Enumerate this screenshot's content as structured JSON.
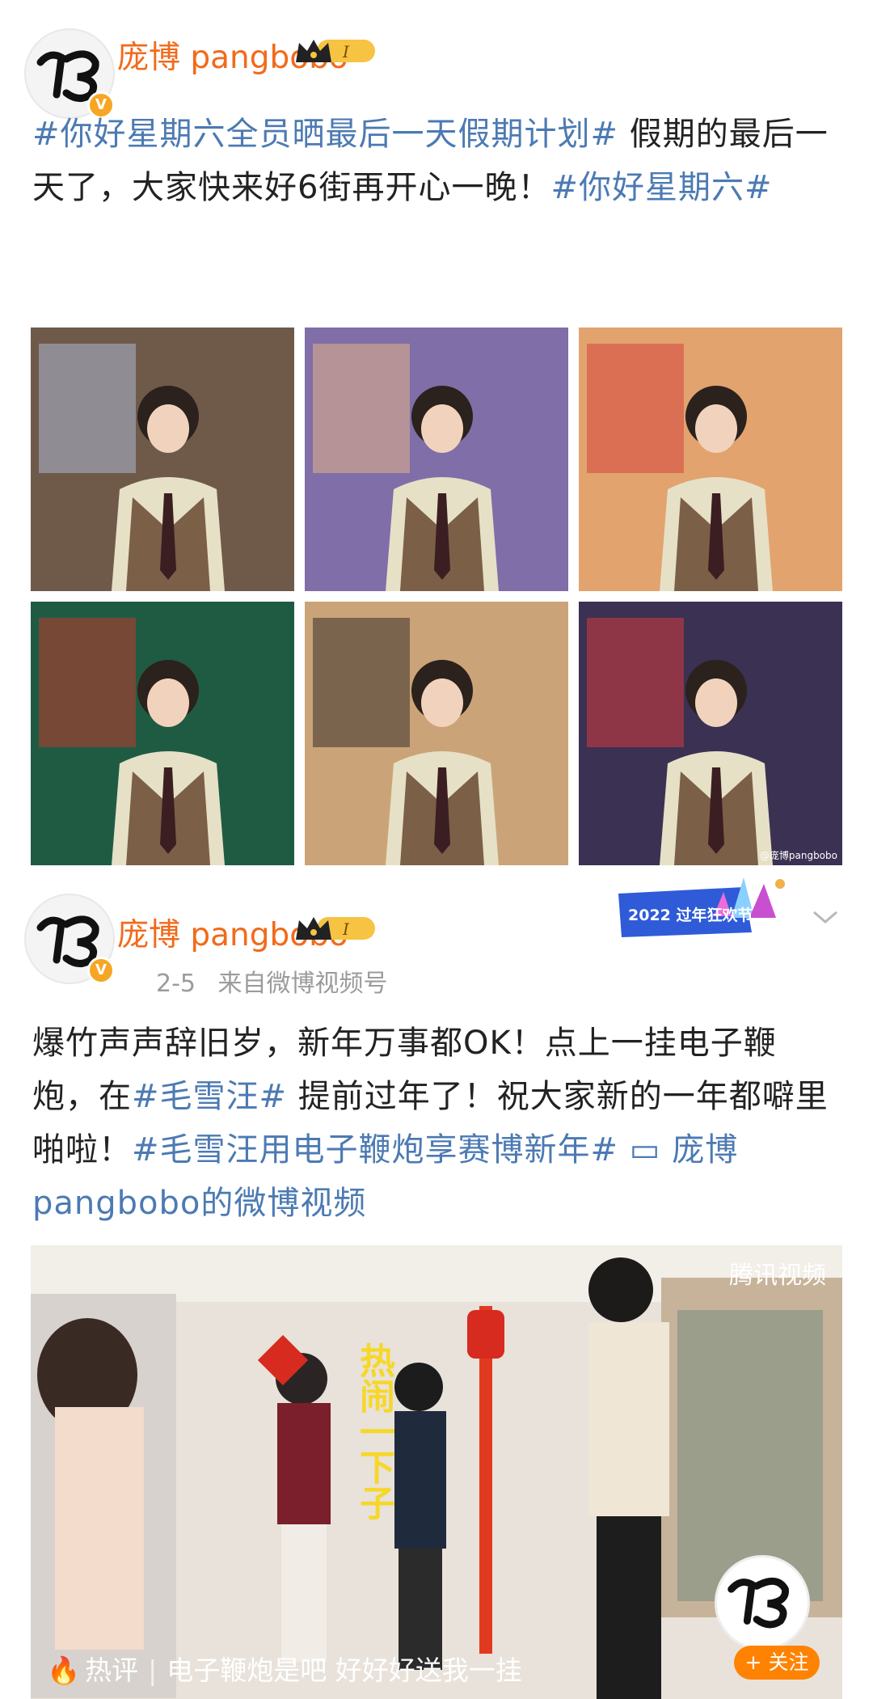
{
  "post1": {
    "username": "庞博 pangbobo",
    "text_segments": [
      {
        "type": "topic",
        "text": "#你好星期六全员晒最后一天假期计划#"
      },
      {
        "type": "plain",
        "text": " 假期的最后一天了，大家快来好6街再开心一晚！"
      },
      {
        "type": "topic",
        "text": "#你好星期六#"
      }
    ],
    "photos": [
      {
        "bg": "#6f5a4a",
        "accent": "#aab8d0"
      },
      {
        "bg": "#7f6ea7",
        "accent": "#e3b28a"
      },
      {
        "bg": "#e2a36f",
        "accent": "#d6463e"
      },
      {
        "bg": "#1f5b43",
        "accent": "#c0392b"
      },
      {
        "bg": "#caa478",
        "accent": "#3a302b"
      },
      {
        "bg": "#3b3152",
        "accent": "#d43b3b"
      }
    ],
    "photo_watermark": "@庞博pangbobo"
  },
  "post2": {
    "username": "庞博 pangbobo",
    "date": "2-5",
    "source_prefix": "来自",
    "source": "微博视频号",
    "banner_text": "2022 过年狂欢节",
    "text_segments": [
      {
        "type": "plain",
        "text": "爆竹声声辞旧岁，新年万事都OK！点上一挂电子鞭炮，在"
      },
      {
        "type": "topic",
        "text": "#毛雪汪#"
      },
      {
        "type": "plain",
        "text": " 提前过年了！祝大家新的一年都噼里啪啦！"
      },
      {
        "type": "topic",
        "text": "#毛雪汪用电子鞭炮享赛博新年#"
      },
      {
        "type": "plain",
        "text": " "
      },
      {
        "type": "link",
        "text": "▭ 庞博 pangbobo的微博视频"
      }
    ],
    "video": {
      "watermark": "腾讯视频",
      "hot_label": "热评",
      "hot_comment": "电子鞭炮是吧  好好好送我一挂",
      "follow_label": "+ 关注",
      "caption_chars": "热闹一下子"
    }
  },
  "colors": {
    "accent_orange": "#f26a1b",
    "link_blue": "#4c7ab3",
    "follow_orange": "#ff8200"
  }
}
